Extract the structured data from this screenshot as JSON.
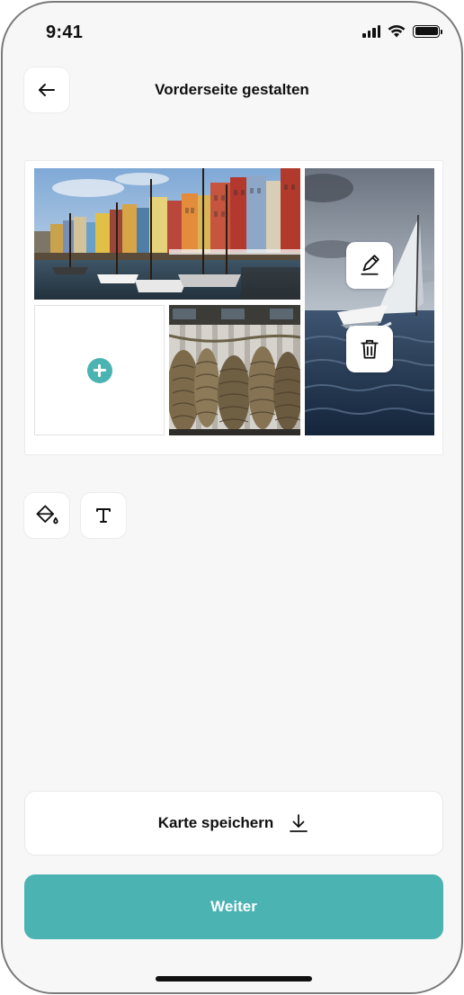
{
  "status_bar": {
    "time": "9:41",
    "icons": [
      "signal-icon",
      "wifi-icon",
      "battery-icon"
    ]
  },
  "header": {
    "title": "Vorderseite gestalten",
    "back_icon": "arrow-left-icon"
  },
  "card": {
    "photos": [
      "harbor-photo",
      "ropes-photo",
      "sailboat-photo"
    ],
    "empty_slot_icon": "plus-icon",
    "overlay_actions": [
      "edit-icon",
      "trash-icon"
    ]
  },
  "tools": [
    "paint-bucket-icon",
    "text-icon"
  ],
  "actions": {
    "save_label": "Karte speichern",
    "save_icon": "download-icon",
    "next_label": "Weiter"
  },
  "colors": {
    "accent": "#4BB3B2",
    "background": "#F7F7F7",
    "surface": "#FFFFFF"
  }
}
